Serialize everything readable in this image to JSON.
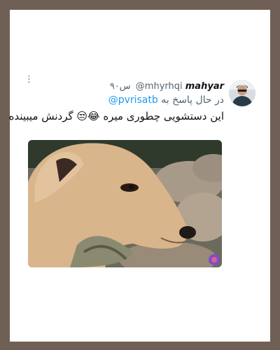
{
  "tweet": {
    "display_name": "mahyar",
    "handle": "@mhyrhqi",
    "time": "۹۰س",
    "reply_prefix": "در حال پاسخ به",
    "reply_to": "@pvrisatb",
    "text": "این دستشویی چطوری میره 😂😒 گردنش میبینده",
    "more_icon": "more-options-icon"
  },
  "colors": {
    "background": "#6f5f55",
    "card": "#ffffff",
    "link": "#1d9bf0",
    "secondary_text": "#536471",
    "primary_text": "#0f1419"
  }
}
